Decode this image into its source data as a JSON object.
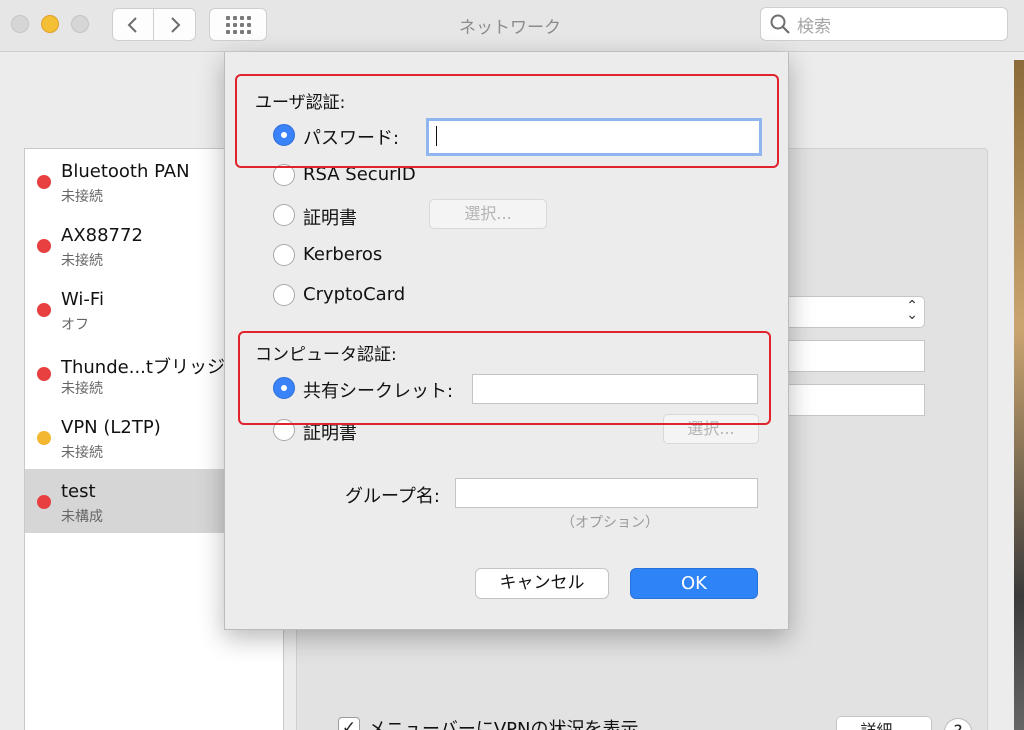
{
  "window": {
    "title": "ネットワーク"
  },
  "search": {
    "placeholder": "検索"
  },
  "services": [
    {
      "name": "Bluetooth PAN",
      "status": "未接続",
      "color": "#e84040"
    },
    {
      "name": "AX88772",
      "status": "未接続",
      "color": "#e84040"
    },
    {
      "name": "Wi-Fi",
      "status": "オフ",
      "color": "#e84040"
    },
    {
      "name": "Thunde...tブリッジ",
      "status": "未接続",
      "color": "#e84040"
    },
    {
      "name": "VPN (L2TP)",
      "status": "未接続",
      "color": "#f4b731"
    },
    {
      "name": "test",
      "status": "未構成",
      "color": "#e84040",
      "selected": true
    }
  ],
  "background": {
    "menubar_checkbox_label": "メニューバーにVPNの状況を表示",
    "menubar_checked": true,
    "detail_button": "詳細...",
    "help_label": "?"
  },
  "dialog": {
    "user_auth": {
      "label": "ユーザ認証:",
      "options": [
        {
          "label": "パスワード:",
          "selected": true
        },
        {
          "label": "RSA SecurID",
          "selected": false
        },
        {
          "label": "証明書",
          "selected": false
        },
        {
          "label": "Kerberos",
          "selected": false
        },
        {
          "label": "CryptoCard",
          "selected": false
        }
      ],
      "password_value": "",
      "select_button": "選択..."
    },
    "machine_auth": {
      "label": "コンピュータ認証:",
      "options": [
        {
          "label": "共有シークレット:",
          "selected": true
        },
        {
          "label": "証明書",
          "selected": false
        }
      ],
      "shared_secret_value": "",
      "select_button": "選択..."
    },
    "group": {
      "label": "グループ名:",
      "value": "",
      "optional_note": "（オプション）"
    },
    "cancel_button": "キャンセル",
    "ok_button": "OK",
    "highlight_color": "#e0232c"
  }
}
